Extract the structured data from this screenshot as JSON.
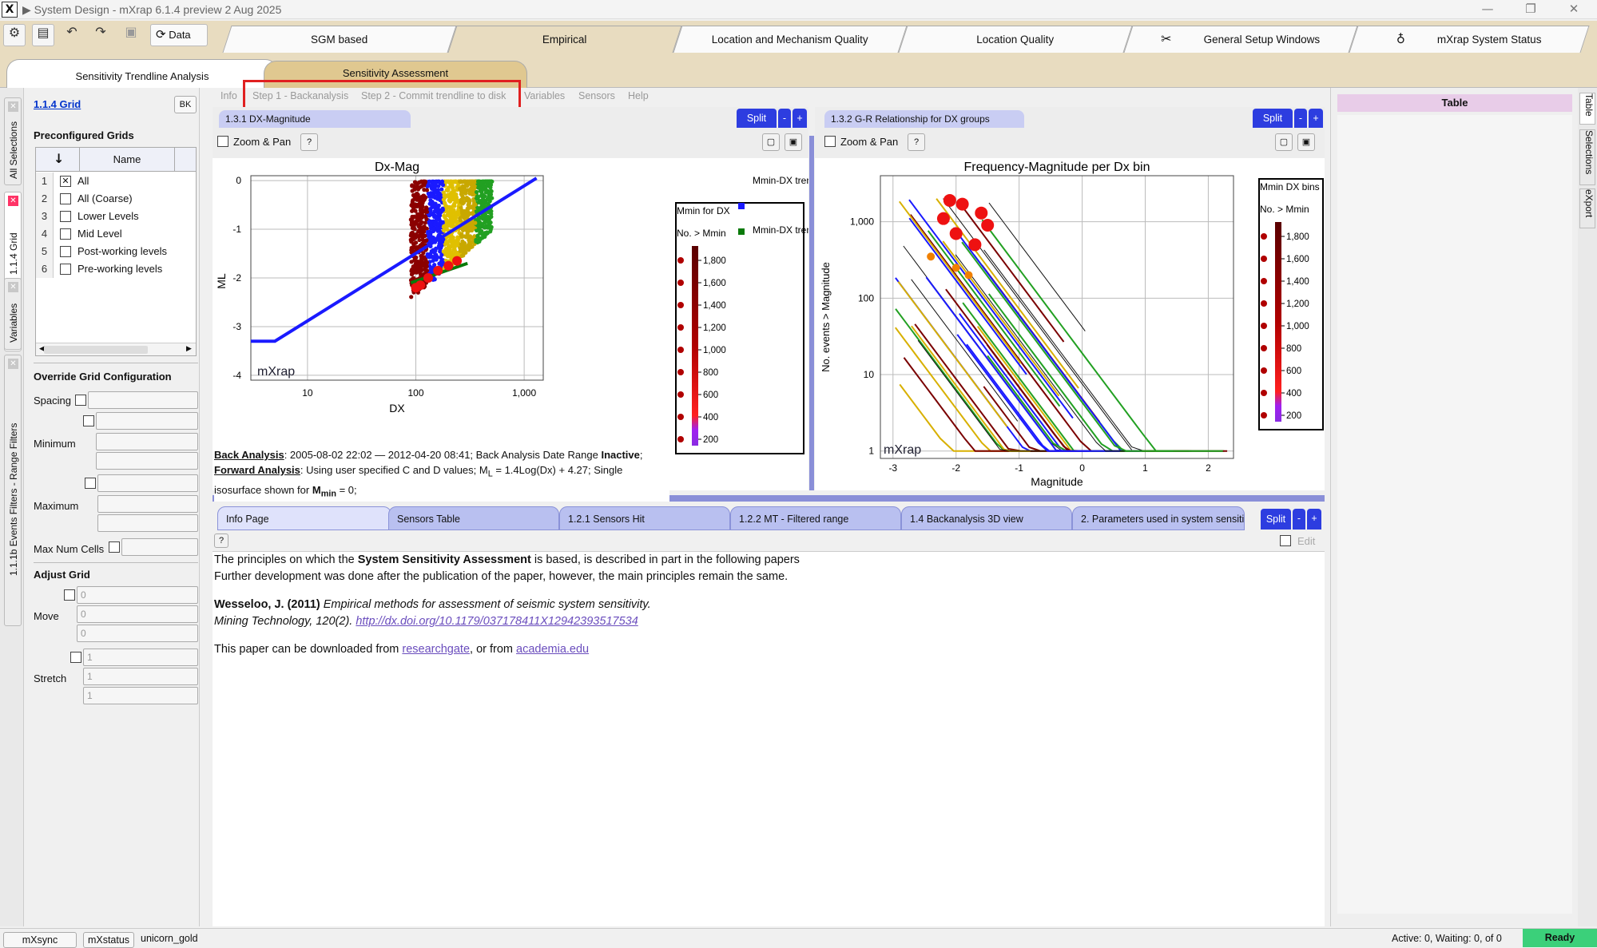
{
  "window": {
    "title": "▶ System Design - mXrap 6.1.4 preview 2 Aug 2025",
    "app_glyph": "X"
  },
  "toolbar": {
    "data_label": "Data"
  },
  "main_tabs": [
    "SGM based",
    "Empirical",
    "Location and Mechanism Quality",
    "Location Quality",
    "General Setup Windows",
    "mXrap System Status"
  ],
  "sub_tabs": [
    "Sensitivity Trendline Analysis",
    "Sensitivity Assessment"
  ],
  "left_vtabs": [
    "All Selections",
    "1.1.4 Grid",
    "Variables",
    "1.1.1b Events Filters - Range Filters"
  ],
  "left_panel": {
    "grid_title": "1.1.4 Grid",
    "bk_label": "BK",
    "preconfigured_heading": "Preconfigured Grids",
    "name_header": "Name",
    "rows": [
      {
        "n": "1",
        "label": "All",
        "checked": true
      },
      {
        "n": "2",
        "label": "All (Coarse)",
        "checked": false
      },
      {
        "n": "3",
        "label": "Lower Levels",
        "checked": false
      },
      {
        "n": "4",
        "label": "Mid Level",
        "checked": false
      },
      {
        "n": "5",
        "label": "Post-working levels",
        "checked": false
      },
      {
        "n": "6",
        "label": "Pre-working levels",
        "checked": false
      }
    ],
    "override_heading": "Override Grid Configuration",
    "spacing_label": "Spacing",
    "minimum_label": "Minimum",
    "maximum_label": "Maximum",
    "max_cells_label": "Max Num Cells",
    "adjust_heading": "Adjust Grid",
    "move_label": "Move",
    "move_values": [
      "0",
      "0",
      "0"
    ],
    "stretch_label": "Stretch",
    "stretch_values": [
      "1",
      "1",
      "1"
    ]
  },
  "menu": {
    "info": "Info",
    "step1": "Step 1 - Backanalysis",
    "step2": "Step 2 - Commit trendline to disk",
    "variables": "Variables",
    "sensors": "Sensors",
    "help": "Help"
  },
  "left_plot": {
    "tab_title": "1.3.1 DX-Magnitude",
    "split_label": "Split",
    "zoom_label": "Zoom & Pan",
    "help_label": "?",
    "watermark": "mXrap",
    "legend_head1": "Mmin for DX",
    "legend_head2": "No. > Mmin",
    "legend_items": [
      "Mmin-DX trend (Specified)",
      "Mmin-DX trend (best-fit)"
    ],
    "back_analysis_label": "Back Analysis",
    "back_analysis_text": ": 2005-08-02 22:02 — 2012-04-20 08:41; Back Analysis Date Range ",
    "inactive_label": "Inactive",
    "forward_label": "Forward Analysis",
    "forward_text": ": Using user specified C and D values; M",
    "forward_sub": "L",
    "forward_text2": " = 1.4Log(Dx) + 4.27; Single isosurface shown for ",
    "mmin_label": "M",
    "mmin_sub": "min",
    "mmin_value": " = 0;"
  },
  "right_plot": {
    "tab_title": "1.3.2 G-R Relationship for DX groups",
    "split_label": "Split",
    "zoom_label": "Zoom & Pan",
    "help_label": "?",
    "watermark": "mXrap",
    "legend_head1": "Mmin DX bins",
    "legend_head2": "No. > Mmin"
  },
  "chart_data": [
    {
      "type": "scatter",
      "title": "Dx-Mag",
      "xlabel": "DX",
      "ylabel": "ML",
      "x_scale": "log",
      "xlim": [
        3,
        1500
      ],
      "ylim": [
        -4.1,
        0.1
      ],
      "x_ticks": [
        "10",
        "100",
        "1,000"
      ],
      "y_ticks": [
        "0",
        "-1",
        "-2",
        "-3",
        "-4"
      ],
      "series": [
        {
          "name": "Mmin-DX trend (Specified)",
          "color": "#1a1aff",
          "points": [
            [
              3,
              -3.3
            ],
            [
              5,
              -3.3
            ],
            [
              1300,
              0.05
            ]
          ]
        },
        {
          "name": "Mmin-DX trend (best-fit)",
          "color": "#0a7a0a",
          "points": [
            [
              90,
              -2.1
            ],
            [
              300,
              -1.7
            ]
          ]
        }
      ],
      "colorbar_ticks": [
        "1,800",
        "1,600",
        "1,400",
        "1,200",
        "1,000",
        "800",
        "600",
        "400",
        "200"
      ]
    },
    {
      "type": "line",
      "title": "Frequency-Magnitude per Dx bin",
      "xlabel": "Magnitude",
      "ylabel": "No. events > Magnitude",
      "y_scale": "log",
      "xlim": [
        -3.2,
        2.4
      ],
      "ylim": [
        0.8,
        4000
      ],
      "x_ticks": [
        "-3",
        "-2",
        "-1",
        "0",
        "1",
        "2"
      ],
      "y_ticks": [
        "1,000",
        "100",
        "10",
        "1"
      ],
      "colorbar_ticks": [
        "1,800",
        "1,600",
        "1,400",
        "1,200",
        "1,000",
        "800",
        "600",
        "400",
        "200"
      ]
    }
  ],
  "bottom_tabs": [
    "Info Page",
    "Sensors Table",
    "1.2.1 Sensors Hit",
    "1.2.2 MT - Filtered range",
    "1.4 Backanalysis 3D view",
    "2. Parameters used in system sensiti"
  ],
  "bottom_split": "Split",
  "edit_label": "Edit",
  "info_page": {
    "p1a": "The principles on which the ",
    "p1b": "System Sensitivity Assessment",
    "p1c": " is based, is described in part in the following papers",
    "p2": "Further development was done after the publication of the paper, however, the main principles remain the same.",
    "ref_author": "Wesseloo, J. (2011)",
    "ref_title": " Empirical methods for assessment of seismic system sensitivity.",
    "ref_journal": "Mining Technology, 120(2).",
    "ref_link": "http://dx.doi.org/10.1179/037178411X12942393517534",
    "dl_a": "This paper can be downloaded from ",
    "dl_link1": "researchgate",
    "dl_b": ", or from ",
    "dl_link2": "academia.edu"
  },
  "right_panel": {
    "table_title": "Table"
  },
  "right_vtabs": [
    "Table",
    "Selections",
    "eXport"
  ],
  "status": {
    "btn1": "mXsync",
    "btn2": "mXstatus",
    "user": "unicorn_gold",
    "active": "Active: 0, Waiting: 0, of 0",
    "ready": "Ready"
  }
}
